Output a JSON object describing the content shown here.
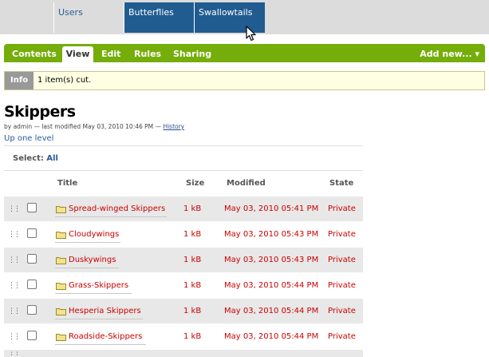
{
  "topnav": {
    "tabs": [
      {
        "label": "Users",
        "selected": false
      },
      {
        "label": "Butterflies",
        "selected": true
      },
      {
        "label": "Swallowtails",
        "selected": true
      }
    ]
  },
  "contentbar": {
    "tabs": [
      "Contents",
      "View",
      "Edit",
      "Rules",
      "Sharing"
    ],
    "active_tab": "View",
    "add_new": "Add new... ▾"
  },
  "message": {
    "label": "Info",
    "text": "1 item(s) cut."
  },
  "page": {
    "title": "Skippers",
    "byline": "by admin — last modified May 03, 2010 10:46 PM —",
    "history_link": "History",
    "up_one_level": "Up one level",
    "select_label": "Select:",
    "select_all": "All"
  },
  "table": {
    "headers": {
      "title": "Title",
      "size": "Size",
      "modified": "Modified",
      "state": "State"
    },
    "rows": [
      {
        "title": "Spread-winged Skippers",
        "size": "1 kB",
        "modified": "May 03, 2010 05:41 PM",
        "state": "Private"
      },
      {
        "title": "Cloudywings",
        "size": "1 kB",
        "modified": "May 03, 2010 05:43 PM",
        "state": "Private"
      },
      {
        "title": "Duskywings",
        "size": "1 kB",
        "modified": "May 03, 2010 05:43 PM",
        "state": "Private"
      },
      {
        "title": "Grass-Skippers",
        "size": "1 kB",
        "modified": "May 03, 2010 05:44 PM",
        "state": "Private"
      },
      {
        "title": "Hesperia Skippers",
        "size": "1 kB",
        "modified": "May 03, 2010 05:44 PM",
        "state": "Private"
      },
      {
        "title": "Roadside-Skippers",
        "size": "1 kB",
        "modified": "May 03, 2010 05:44 PM",
        "state": "Private"
      }
    ]
  },
  "colors": {
    "nav_selected": "#205c90",
    "bar_green": "#75ad0a",
    "link_red": "#cc0000",
    "info_bg": "#ffffe3"
  }
}
